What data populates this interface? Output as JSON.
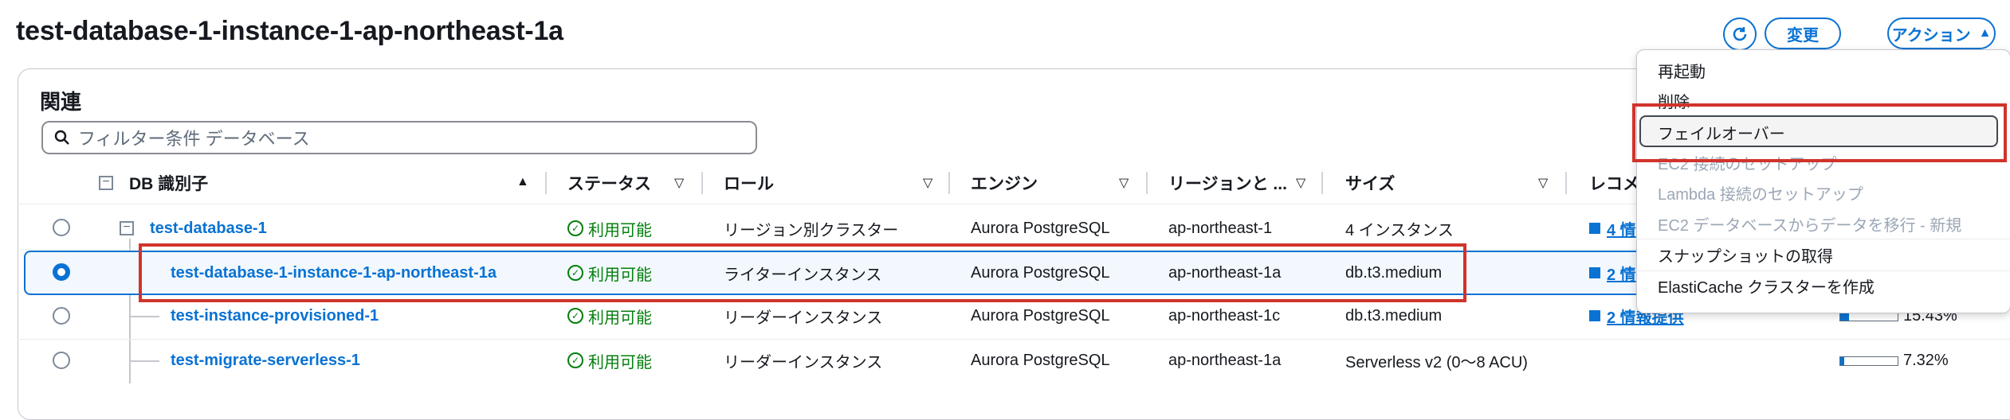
{
  "page": {
    "title": "test-database-1-instance-1-ap-northeast-1a"
  },
  "header_buttons": {
    "modify": "変更",
    "actions": "アクション",
    "actions_caret": "▲",
    "refresh_icon": "refresh-icon"
  },
  "panel": {
    "title": "関連",
    "filter_placeholder": "フィルター条件 データベース"
  },
  "columns": {
    "db_id": "DB 識別子",
    "status": "ステータス",
    "role": "ロール",
    "engine": "エンジン",
    "region": "リージョンと ...",
    "size": "サイズ",
    "recommend": "レコメ"
  },
  "rows": [
    {
      "id": "test-database-1",
      "status": "利用可能",
      "role": "リージョン別クラスター",
      "engine": "Aurora PostgreSQL",
      "region": "ap-northeast-1",
      "size": "4 インスタンス",
      "rec": "4 情",
      "cpu": ""
    },
    {
      "id": "test-database-1-instance-1-ap-northeast-1a",
      "status": "利用可能",
      "role": "ライターインスタンス",
      "engine": "Aurora PostgreSQL",
      "region": "ap-northeast-1a",
      "size": "db.t3.medium",
      "rec": "2 情",
      "cpu": ""
    },
    {
      "id": "test-instance-provisioned-1",
      "status": "利用可能",
      "role": "リーダーインスタンス",
      "engine": "Aurora PostgreSQL",
      "region": "ap-northeast-1c",
      "size": "db.t3.medium",
      "rec": "2 情報提供",
      "cpu": "15.43%",
      "cpu_value": 0.1543
    },
    {
      "id": "test-migrate-serverless-1",
      "status": "利用可能",
      "role": "リーダーインスタンス",
      "engine": "Aurora PostgreSQL",
      "region": "ap-northeast-1a",
      "size": "Serverless v2 (0～8 ACU)",
      "rec": "",
      "cpu": "7.32%",
      "cpu_value": 0.0732
    }
  ],
  "menu": {
    "items": [
      {
        "label": "再起動",
        "disabled": false
      },
      {
        "label": "削除",
        "disabled": false
      },
      {
        "label": "フェイルオーバー",
        "disabled": false
      },
      {
        "label": "EC2 接続のセットアップ",
        "disabled": true
      },
      {
        "label": "Lambda 接続のセットアップ",
        "disabled": true
      },
      {
        "label": "EC2 データベースからデータを移行 - 新規",
        "disabled": true
      },
      {
        "label": "スナップショットの取得",
        "disabled": false
      },
      {
        "label": "ElastiCache クラスターを作成",
        "disabled": false
      }
    ]
  },
  "colors": {
    "accent": "#0972d3",
    "success": "#037f0c",
    "highlight": "#d1332b"
  }
}
